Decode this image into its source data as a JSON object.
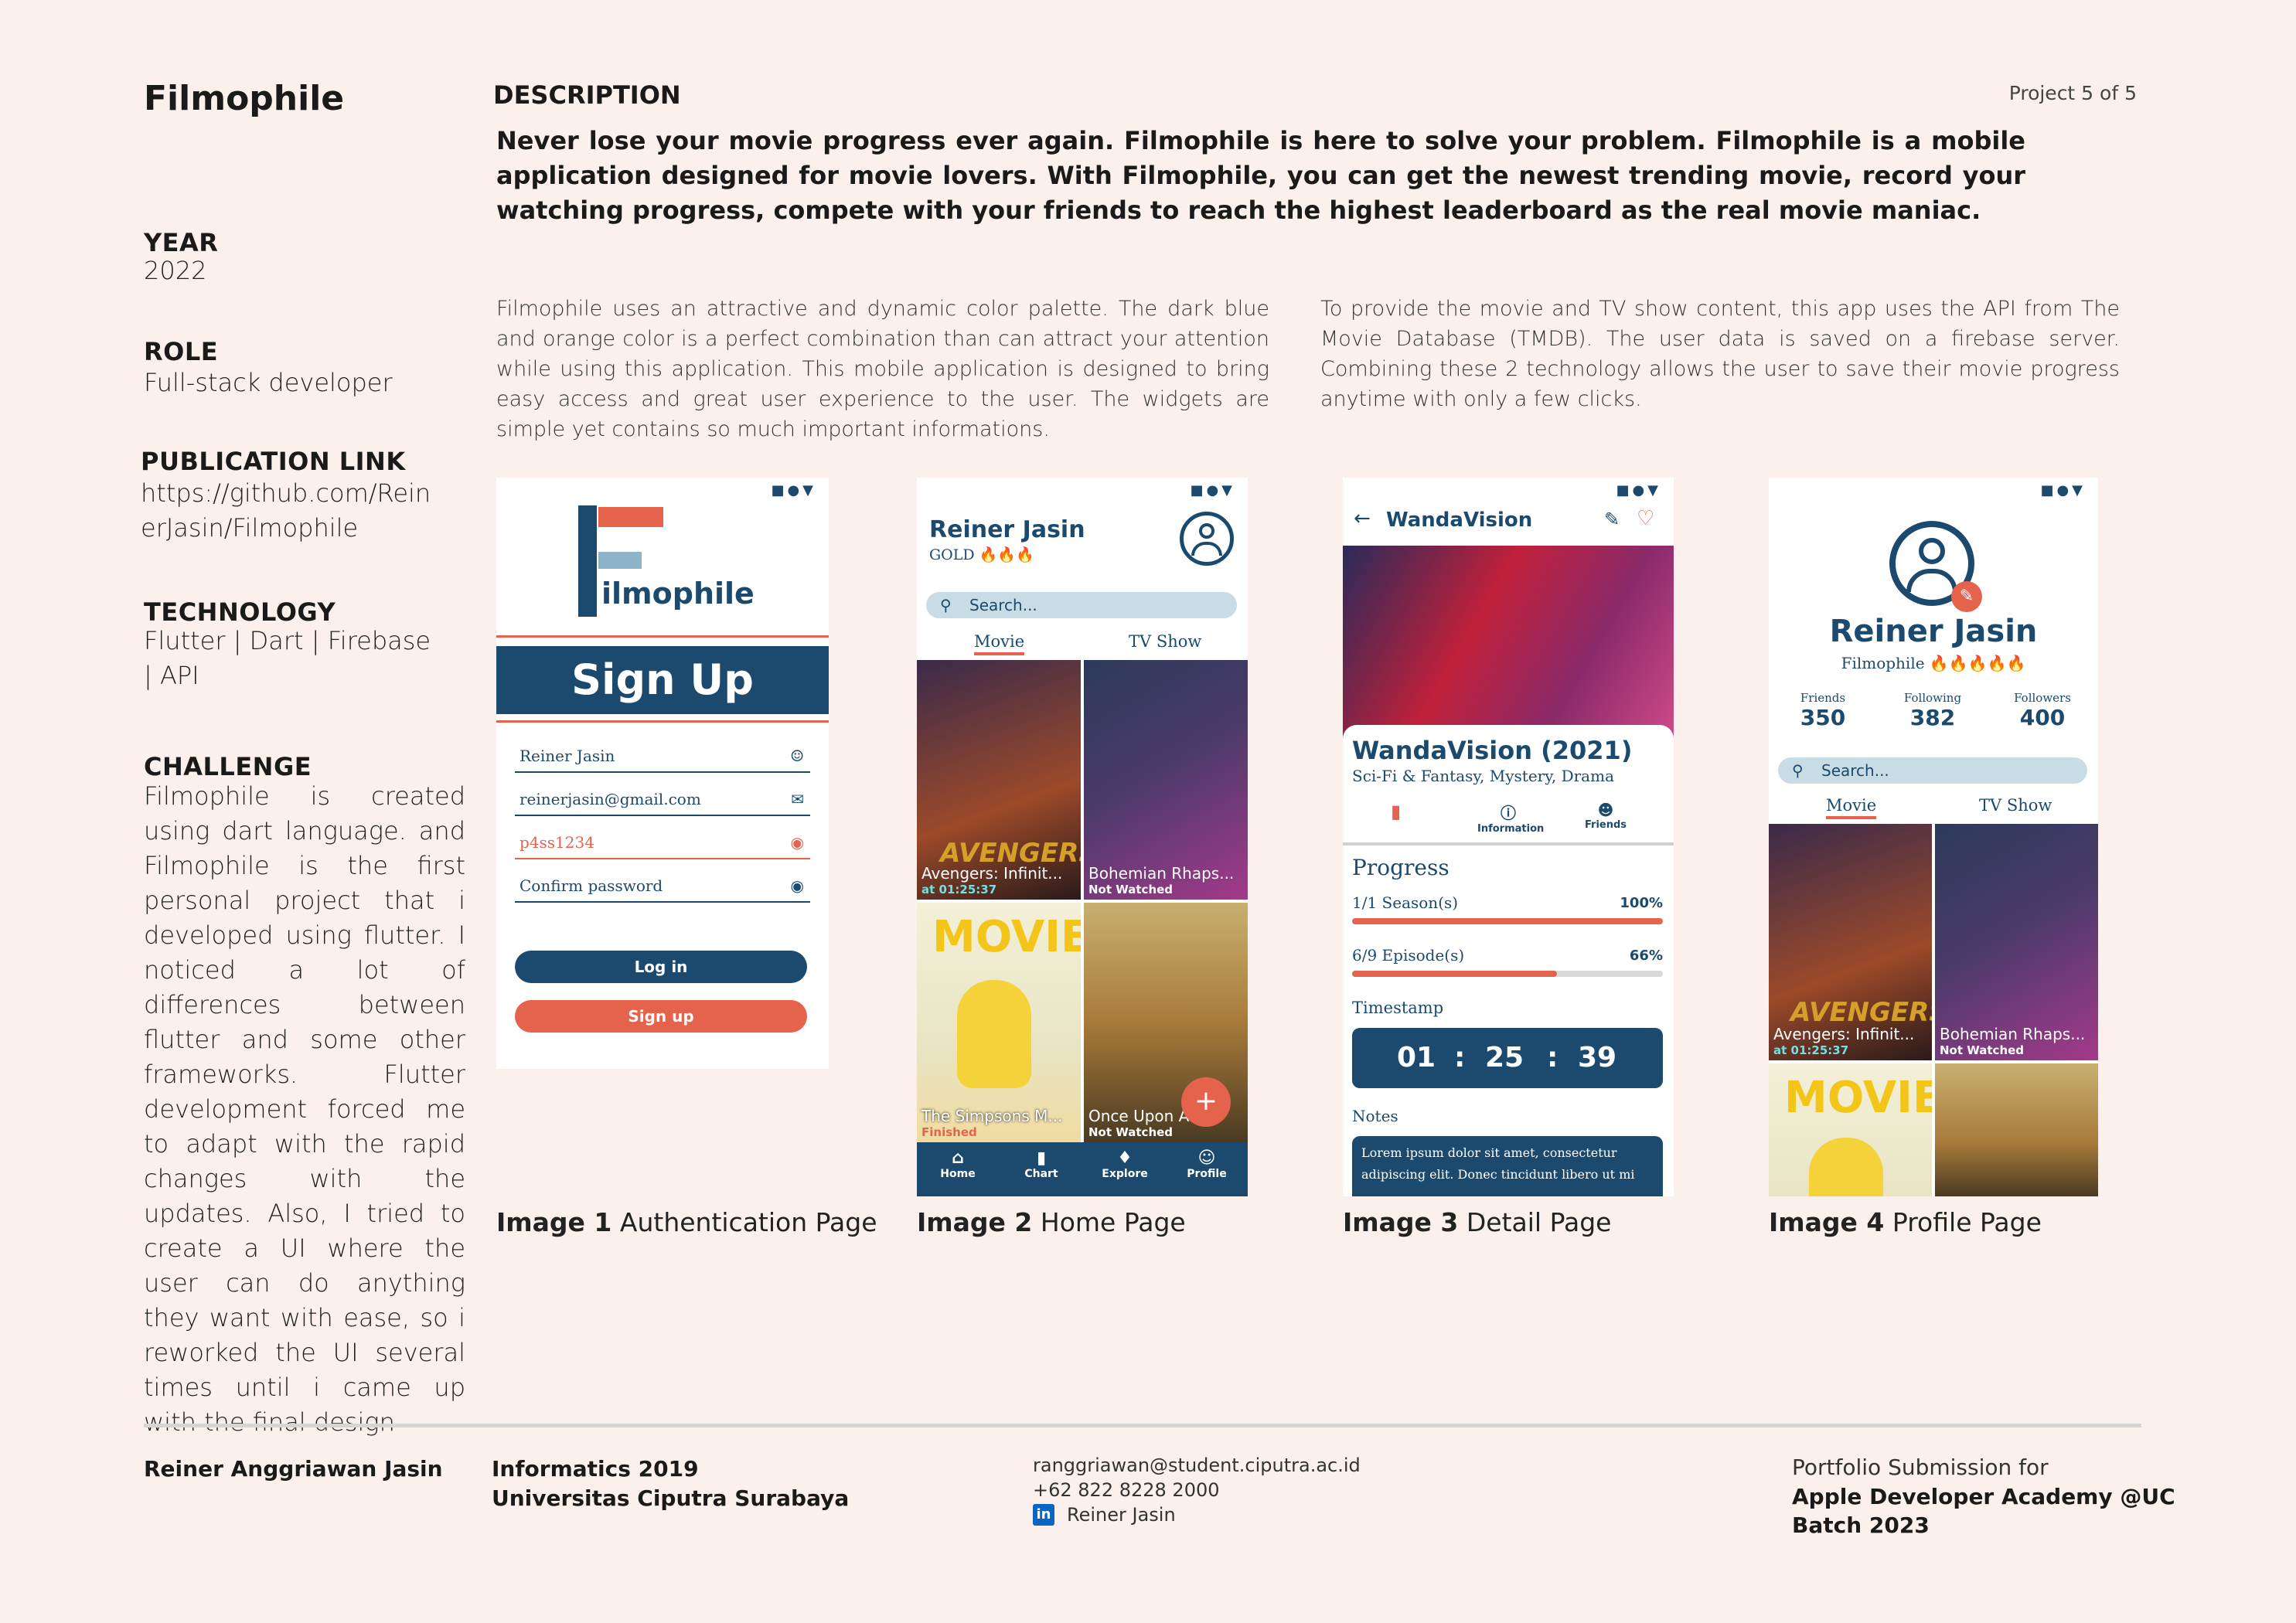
{
  "project": {
    "title": "Filmophile",
    "counter": "Project 5 of 5"
  },
  "sidebar": {
    "year_label": "YEAR",
    "year": "2022",
    "role_label": "ROLE",
    "role": "Full-stack developer",
    "link_label": "PUBLICATION LINK",
    "link": "https://github.com/ReinerJasin/Filmophile",
    "tech_label": "TECHNOLOGY",
    "tech": "Flutter | Dart | Firebase | API",
    "challenge_label": "CHALLENGE",
    "challenge": "Filmophile is created using dart language. and Filmophile is the first personal project that i developed using flutter. I noticed a lot of differences between flutter and some other frameworks. Flutter development forced me to adapt with the rapid changes with the updates. Also, I tried to create a UI where the user can do anything they want with ease, so i reworked the UI several times until i came up with the final design"
  },
  "description": {
    "heading": "DESCRIPTION",
    "lead": "Never lose your movie progress ever again. Filmophile is here to solve your problem. Filmophile is a mobile application designed for movie lovers. With Filmophile, you can get the newest trending movie, record your watching progress, compete with your friends to reach the highest leaderboard as the real movie maniac.",
    "col1": "Filmophile uses an attractive and dynamic color palette. The dark blue and orange color is a perfect combination than can attract your attention while using this application. This mobile application is designed to bring easy access and great user experience to the user. The widgets are simple yet contains so much important informations.",
    "col2": "To provide the movie and TV show content, this app uses the API from The Movie Database (TMDB). The user data is saved on a firebase server. Combining these 2 technology allows the user to save their movie progress anytime with only a few clicks."
  },
  "captions": [
    {
      "num": "Image 1",
      "text": "Authentication Page"
    },
    {
      "num": "Image 2",
      "text": "Home Page"
    },
    {
      "num": "Image 3",
      "text": "Detail Page"
    },
    {
      "num": "Image 4",
      "text": "Profile Page"
    }
  ],
  "screen1": {
    "status": "■●▼",
    "logo_text": "ilmophile",
    "heading": "Sign Up",
    "name": "Reiner Jasin",
    "email": "reinerjasin@gmail.com",
    "password": "p4ss1234",
    "confirm": "Confirm password",
    "login": "Log in",
    "signup": "Sign up"
  },
  "screen2": {
    "status": "■●▼",
    "user": "Reiner Jasin",
    "rank": "GOLD 🔥🔥🔥",
    "search": "Search...",
    "tab_movie": "Movie",
    "tab_tv": "TV Show",
    "tiles": [
      {
        "title": "Avengers: Infinit...",
        "status": "at 01:25:37"
      },
      {
        "title": "Bohemian Rhaps...",
        "status": "Not Watched"
      },
      {
        "title": "The Simpsons M...",
        "status": "Finished"
      },
      {
        "title": "Once Upon A...",
        "status": "Not Watched"
      }
    ],
    "fab": "+",
    "nav": [
      "Home",
      "Chart",
      "Explore",
      "Profile"
    ]
  },
  "screen3": {
    "status": "■●▼",
    "header": "WandaVision",
    "show_title": "WandaVision (2021)",
    "genres": "Sci-Fi & Fantasy, Mystery, Drama",
    "tabs": [
      "Information",
      "Friends"
    ],
    "progress_label": "Progress",
    "season_label": "1/1 Season(s)",
    "season_pct": "100%",
    "season_value": 1.0,
    "episode_label": "6/9 Episode(s)",
    "episode_pct": "66%",
    "episode_value": 0.66,
    "timestamp_label": "Timestamp",
    "t_h": "01",
    "t_m": "25",
    "t_s": "39",
    "notes_label": "Notes",
    "notes": "Lorem ipsum dolor sit amet, consectetur adipiscing elit. Donec tincidunt libero ut mi"
  },
  "screen4": {
    "status": "■●▼",
    "user": "Reiner Jasin",
    "app": "Filmophile 🔥🔥🔥🔥🔥",
    "stats": [
      {
        "label": "Friends",
        "value": "350"
      },
      {
        "label": "Following",
        "value": "382"
      },
      {
        "label": "Followers",
        "value": "400"
      }
    ],
    "search": "Search...",
    "tab_movie": "Movie",
    "tab_tv": "TV Show",
    "tiles": [
      {
        "title": "Avengers: Infinit...",
        "status": "at 01:25:37"
      },
      {
        "title": "Bohemian Rhaps...",
        "status": "Not Watched"
      }
    ]
  },
  "footer": {
    "name": "Reiner Anggriawan Jasin",
    "program": "Informatics 2019",
    "university": "Universitas Ciputra Surabaya",
    "email": "ranggriawan@student.ciputra.ac.id",
    "phone": "+62 822 8228 2000",
    "linkedin": "Reiner Jasin",
    "portfolio_label": "Portfolio Submission for",
    "portfolio_1": "Apple Developer Academy @UC",
    "portfolio_2": "Batch 2023"
  },
  "colors": {
    "navy": "#1b4a6e",
    "orange": "#e5634c",
    "background": "#fbf0ec"
  }
}
